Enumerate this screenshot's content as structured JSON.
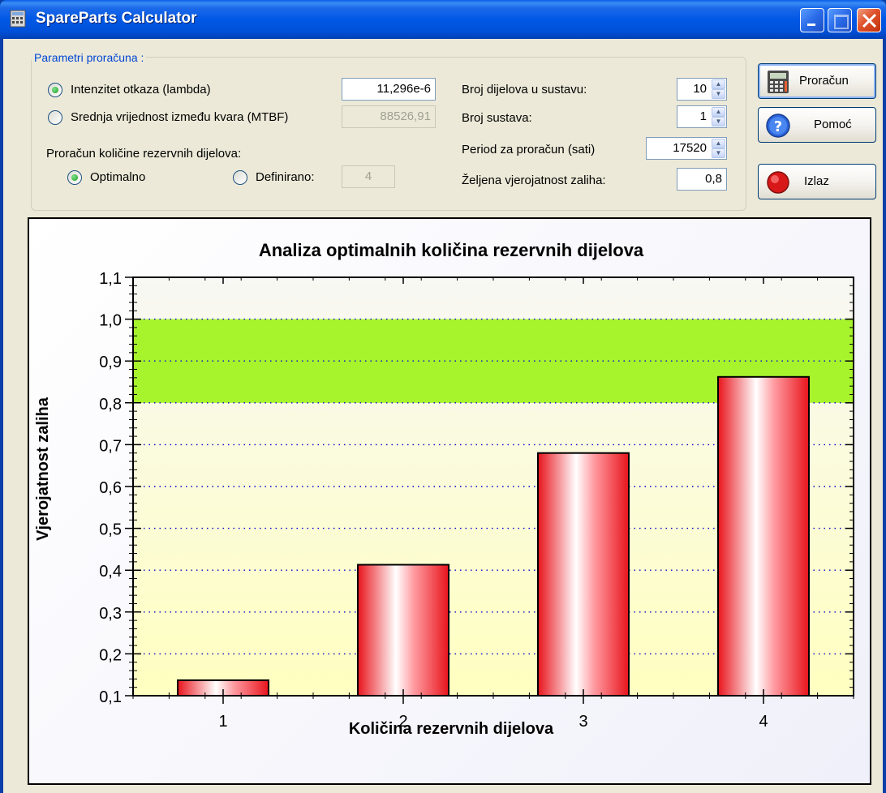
{
  "window": {
    "title": "SpareParts Calculator"
  },
  "group": {
    "legend": "Parametri proračuna :",
    "radio_lambda_label": "Intenzitet otkaza (lambda)",
    "lambda_value": "11,296e-6",
    "radio_mtbf_label": "Srednja vrijednost između kvara (MTBF)",
    "mtbf_value": "88526,91",
    "calc_label": "Proračun količine  rezervnih dijelova:",
    "optimal_label": "Optimalno",
    "defined_label": "Definirano:",
    "defined_value": "4",
    "parts_label": "Broj  dijelova u sustavu:",
    "parts_value": "10",
    "systems_label": "Broj sustava:",
    "systems_value": "1",
    "period_label": "Period za proračun (sati)",
    "period_value": "17520",
    "probability_label": "Željena vjerojatnost zaliha:",
    "probability_value": "0,8"
  },
  "buttons": {
    "calculate": "Proračun",
    "help": "Pomoć",
    "exit": "Izlaz"
  },
  "chart_data": {
    "type": "bar",
    "title": "Analiza optimalnih količina rezervnih dijelova",
    "xlabel": "Količina rezervnih dijelova",
    "ylabel": "Vjerojatnost zaliha",
    "categories": [
      "1",
      "2",
      "3",
      "4"
    ],
    "values": [
      0.137,
      0.413,
      0.68,
      0.862
    ],
    "ylim": [
      0.1,
      1.1
    ],
    "yticks": [
      "0,1",
      "0,2",
      "0,3",
      "0,4",
      "0,5",
      "0,6",
      "0,7",
      "0,8",
      "0,9",
      "1,0",
      "1,1"
    ],
    "target_band": [
      0.8,
      1.0
    ],
    "colors": {
      "bar": "#e8141c",
      "band": "#a8f42c",
      "grid": "#0000d0"
    },
    "grid": true,
    "legend": "none"
  }
}
